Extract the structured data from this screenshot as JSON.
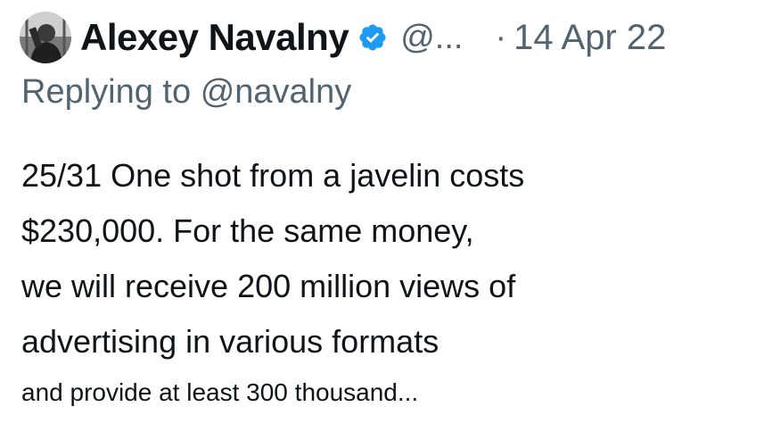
{
  "tweet": {
    "author": {
      "display_name": "Alexey Navalny",
      "handle": "@...",
      "verified": true,
      "verified_icon": "verified-badge-icon",
      "verified_color": "#1d9bf0"
    },
    "separator": "·",
    "date": "14 Apr 22",
    "replying_prefix": "Replying to",
    "replying_to": "@navalny",
    "text_lines": [
      "25/31 One shot from a javelin costs",
      "$230,000. For the same money,",
      "we will receive 200 million views of",
      "advertising in various formats",
      "and provide at least 300 thousand..."
    ]
  }
}
